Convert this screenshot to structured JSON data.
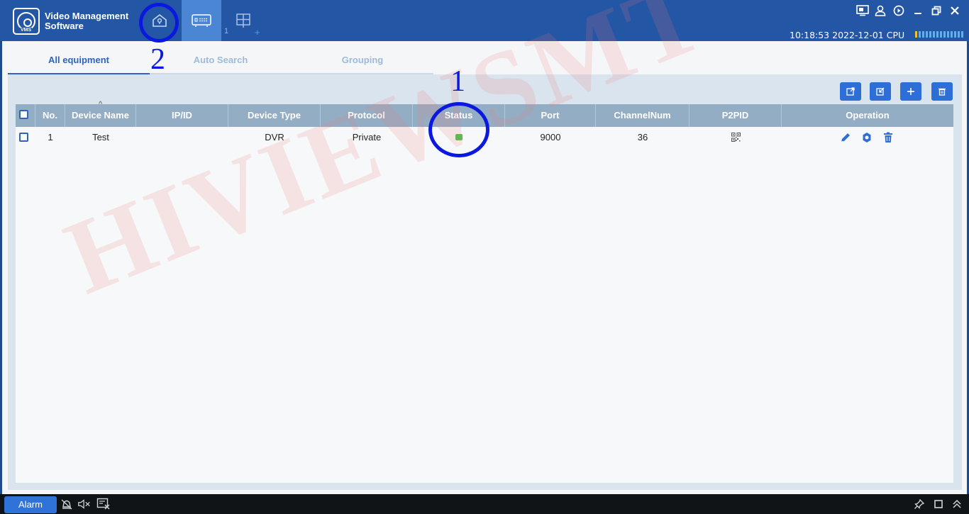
{
  "app": {
    "title_line1": "Video Management",
    "title_line2": "Software",
    "logo_text": "VMS"
  },
  "nav": {
    "tabs": [
      {
        "icon": "home-icon"
      },
      {
        "icon": "device-list-icon",
        "active": true
      },
      {
        "icon": "grid-view-icon"
      }
    ],
    "grid_tab_number": "1",
    "add_tab": "+"
  },
  "window_controls": [
    "screen-icon",
    "user-icon",
    "help-icon",
    "minimize-icon",
    "restore-icon",
    "close-icon"
  ],
  "status_bar": {
    "datetime": "10:18:53 2022-12-01",
    "cpu_label": "CPU"
  },
  "tabs": [
    {
      "label": "All equipment",
      "active": true
    },
    {
      "label": "Auto Search"
    },
    {
      "label": "Grouping"
    }
  ],
  "toolbar": [
    "export-icon",
    "import-icon",
    "add-icon",
    "delete-icon"
  ],
  "table": {
    "headers": [
      "No.",
      "Device Name",
      "IP/ID",
      "Device Type",
      "Protocol",
      "Status",
      "Port",
      "ChannelNum",
      "P2PID",
      "Operation"
    ],
    "sort_indicator": "^",
    "rows": [
      {
        "no": "1",
        "device_name": "Test",
        "ip_id": "",
        "device_type": "DVR",
        "protocol": "Private",
        "status": "online",
        "port": "9000",
        "channel_num": "36",
        "p2pid_icon": "qr-code-icon",
        "operations": [
          "edit-icon",
          "settings-icon",
          "trash-icon"
        ]
      }
    ]
  },
  "colors": {
    "titlebar": "#2456a6",
    "accent": "#2d64c0",
    "status_online": "#4cc04c",
    "annotation": "#0a18e0"
  },
  "watermark": "HIVIEWSMT",
  "annotations": [
    "1",
    "2"
  ],
  "bottom_bar": {
    "alarm_label": "Alarm"
  }
}
